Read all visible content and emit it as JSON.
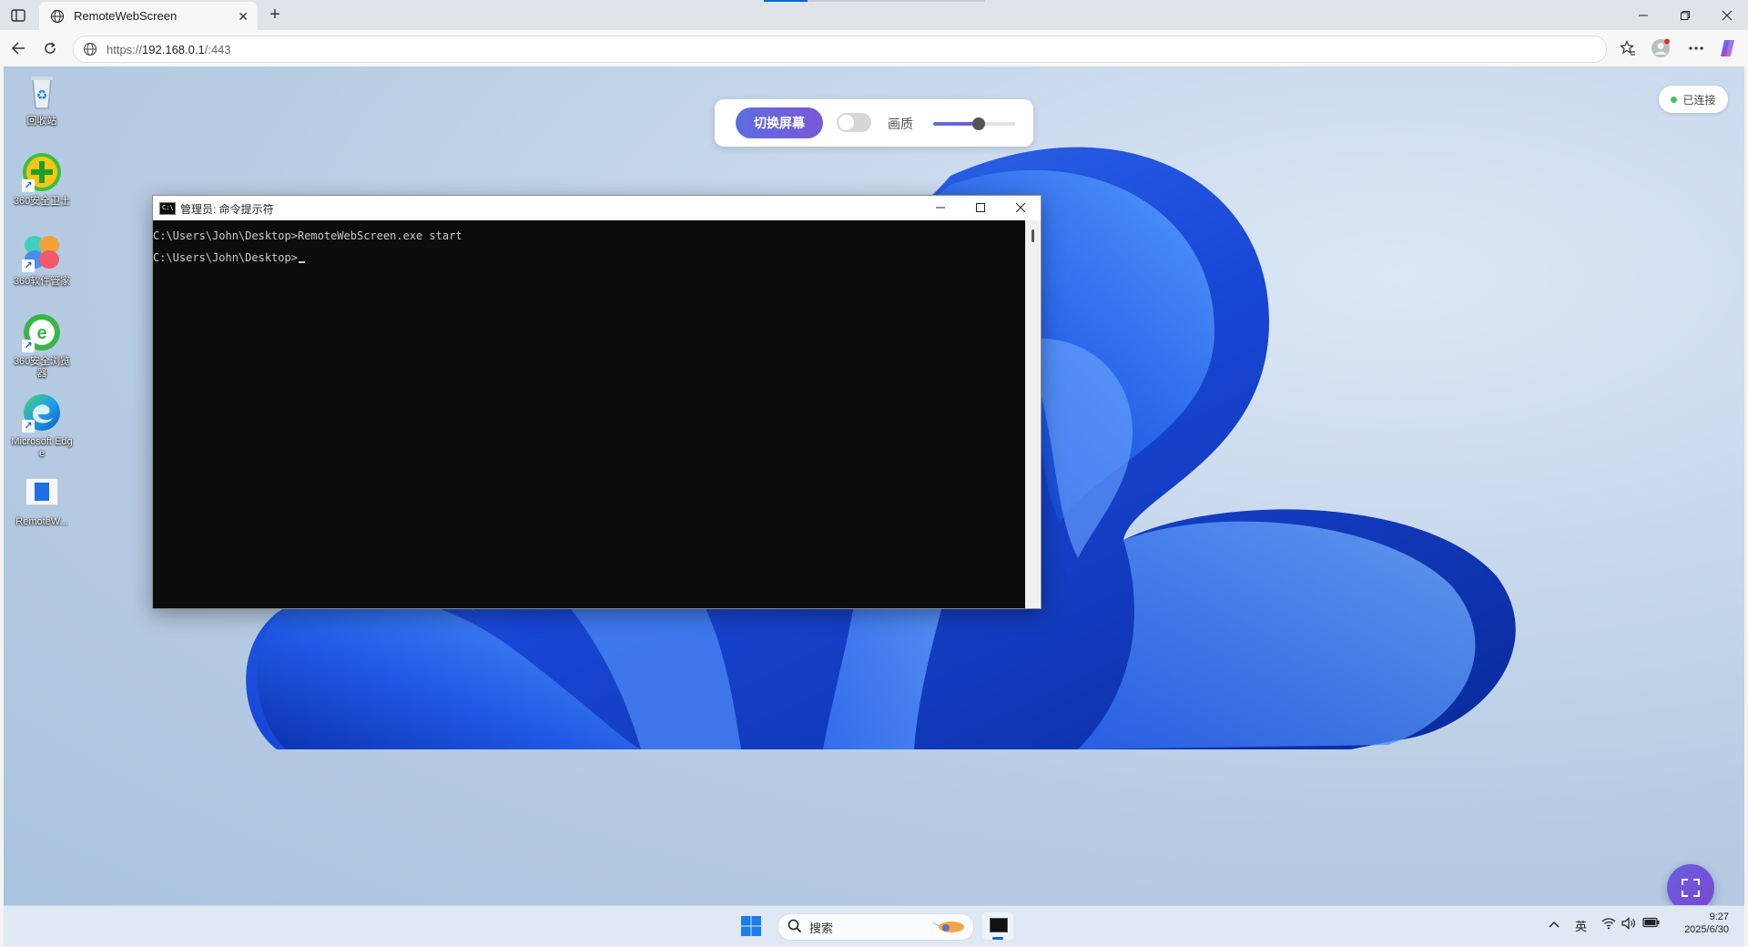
{
  "browser": {
    "tab_title": "RemoteWebScreen",
    "url_proto": "https://",
    "url_host": "192.168.0.1",
    "url_port": "/:443"
  },
  "remote": {
    "desktop_icons": [
      {
        "label": "回收站",
        "icon": "recycle-bin-icon"
      },
      {
        "label": "360安全卫士",
        "icon": "360-security-icon"
      },
      {
        "label": "360软件管家",
        "icon": "360-software-manager-icon"
      },
      {
        "label": "360安全浏览器",
        "icon": "360-browser-icon"
      },
      {
        "label": "Microsoft Edge",
        "icon": "edge-icon"
      },
      {
        "label": "RemoteW...",
        "icon": "remote-app-icon"
      }
    ],
    "control": {
      "switch_label": "切换屏幕",
      "toggle_on": false,
      "quality_label": "画质",
      "quality_value": 0.55,
      "accent": "#6a5ee0"
    },
    "status": "已连接",
    "cmd": {
      "title": "管理员: 命令提示符",
      "lines": [
        "C:\\Users\\John\\Desktop>RemoteWebScreen.exe start",
        "C:\\Users\\John\\Desktop>"
      ]
    },
    "taskbar": {
      "search_placeholder": "搜索",
      "ime": "英",
      "time": "9:27",
      "date": "2025/6/30"
    }
  }
}
